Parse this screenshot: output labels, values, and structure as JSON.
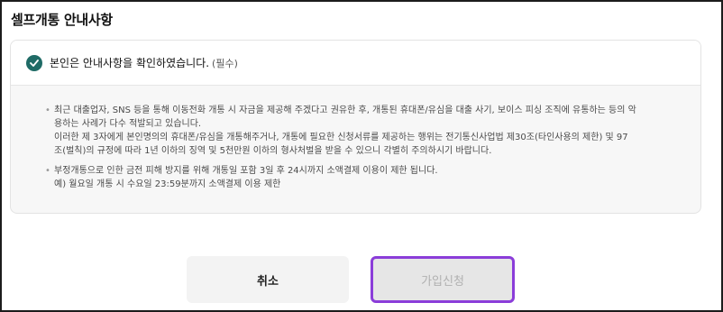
{
  "header": {
    "title": "셀프개통 안내사항"
  },
  "confirm": {
    "label": "본인은 안내사항을 확인하였습니다.",
    "required": "(필수)",
    "checked": true
  },
  "notes": [
    {
      "lines": [
        "최근 대출업자, SNS 등을 통해 이동전화 개통 시 자금을 제공해 주겠다고 권유한 후, 개통된 휴대폰/유심을 대출 사기, 보이스 피싱 조직에 유통하는 등의 악",
        "용하는 사례가 다수 적발되고 있습니다.",
        "이러한 제 3자에게 본인명의의 휴대폰/유심을 개통해주거나, 개통에 필요한 신청서류를 제공하는 행위는 전기통신사업법 제30조(타인사용의 제한) 및 97",
        "조(벌칙)의 규정에 따라 1년 이하의 징역 및 5천만원 이하의 형사처벌을 받을 수 있으니 각별히 주의하시기 바랍니다."
      ]
    },
    {
      "lines": [
        "부정개통으로 인한 금전 피해 방지를 위해 개통일 포함 3일 후 24시까지 소액결제 이용이 제한 됩니다.",
        "예) 월요일 개통 시 수요일 23:59분까지 소액결제 이용 제한"
      ]
    }
  ],
  "buttons": {
    "cancel": "취소",
    "join": "가입신청"
  },
  "colors": {
    "check": "#1f6b66",
    "highlight": "#8b3dd9"
  }
}
